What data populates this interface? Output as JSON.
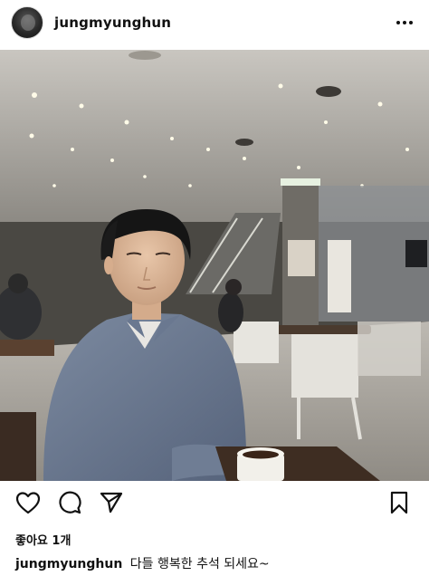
{
  "header": {
    "username": "jungmyunghun",
    "avatar_icon": "profile-avatar",
    "more_icon": "more-horizontal-icon"
  },
  "post": {
    "photo_subject": "photo"
  },
  "actions": {
    "like_icon": "heart-icon",
    "comment_icon": "comment-icon",
    "share_icon": "send-icon",
    "save_icon": "bookmark-icon"
  },
  "likes": {
    "text": "좋아요 1개"
  },
  "caption": {
    "username": "jungmyunghun",
    "text": "다들 행복한 추석 되세요~"
  },
  "colors": {
    "text": "#111111",
    "background": "#ffffff"
  }
}
